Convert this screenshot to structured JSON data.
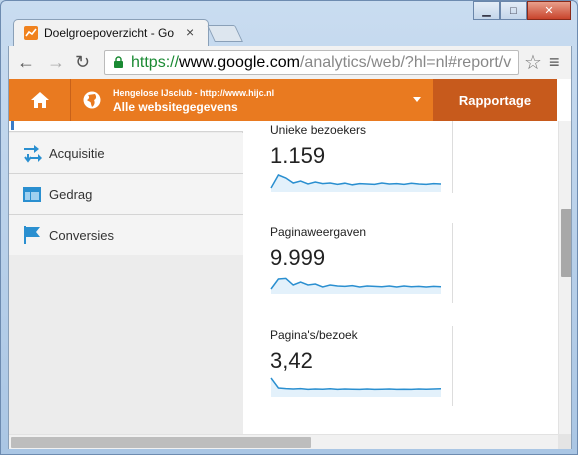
{
  "browser": {
    "tab_title": "Doelgroepoverzicht - Goo",
    "tab_close": "×",
    "back_glyph": "←",
    "forward_glyph": "→",
    "reload_glyph": "↻",
    "star_glyph": "☆",
    "menu_glyph": "≡",
    "url": {
      "scheme": "https://",
      "host": "www.google.com",
      "path": "/analytics/web/?hl=nl#report/v"
    },
    "window_buttons": {
      "minimize": "▁",
      "maximize": "□",
      "close": "✕"
    }
  },
  "analytics_bar": {
    "account_line": "Hengelose IJsclub - http://www.hijc.nl",
    "property_line": "Alle websitegegevens",
    "report_button": "Rapportage",
    "accent_color": "#e97a20",
    "report_color": "#c75a1c"
  },
  "sidebar": {
    "items": [
      {
        "label": "Acquisitie",
        "icon": "acquisition-arrows-icon"
      },
      {
        "label": "Gedrag",
        "icon": "behavior-layout-icon"
      },
      {
        "label": "Conversies",
        "icon": "conversion-flag-icon"
      }
    ]
  },
  "metrics": [
    {
      "label": "Unieke bezoekers",
      "value": "1.159",
      "trend": [
        0.2,
        0.85,
        0.7,
        0.45,
        0.55,
        0.4,
        0.5,
        0.42,
        0.45,
        0.38,
        0.44,
        0.36,
        0.42,
        0.4,
        0.38,
        0.45,
        0.4,
        0.42,
        0.38,
        0.44,
        0.4,
        0.38,
        0.42,
        0.4
      ]
    },
    {
      "label": "Paginaweergaven",
      "value": "9.999",
      "trend": [
        0.25,
        0.75,
        0.78,
        0.45,
        0.6,
        0.45,
        0.5,
        0.35,
        0.45,
        0.4,
        0.38,
        0.42,
        0.35,
        0.4,
        0.38,
        0.36,
        0.4,
        0.35,
        0.4,
        0.36,
        0.38,
        0.35,
        0.38,
        0.36
      ]
    },
    {
      "label": "Pagina's/bezoek",
      "value": "3,42",
      "trend": [
        0.95,
        0.45,
        0.42,
        0.4,
        0.42,
        0.38,
        0.4,
        0.39,
        0.41,
        0.38,
        0.4,
        0.39,
        0.38,
        0.4,
        0.38,
        0.39,
        0.4,
        0.38,
        0.39,
        0.38,
        0.4,
        0.39,
        0.4,
        0.41
      ]
    }
  ],
  "colors": {
    "sparkline": "#2a8fd0",
    "sparkfill": "#e3f1fb"
  }
}
